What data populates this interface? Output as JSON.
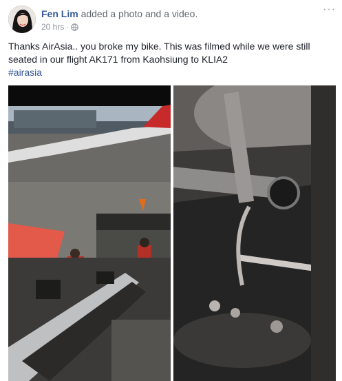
{
  "post": {
    "author": "Fen Lim",
    "action": "added a photo and a video.",
    "timestamp": "20 hrs",
    "separator": "·",
    "more_glyph": "···",
    "text_line1": "Thanks AirAsia.. you broke my bike. This was filmed while we were still",
    "text_line2": "seated in our flight AK171 from Kaohsiung to KLIA2",
    "hashtag": "#airasia"
  },
  "icons": {
    "globe": "globe-icon",
    "more": "more-options-icon"
  },
  "colors": {
    "link": "#365899",
    "meta": "#90949c",
    "text": "#1d2129"
  }
}
